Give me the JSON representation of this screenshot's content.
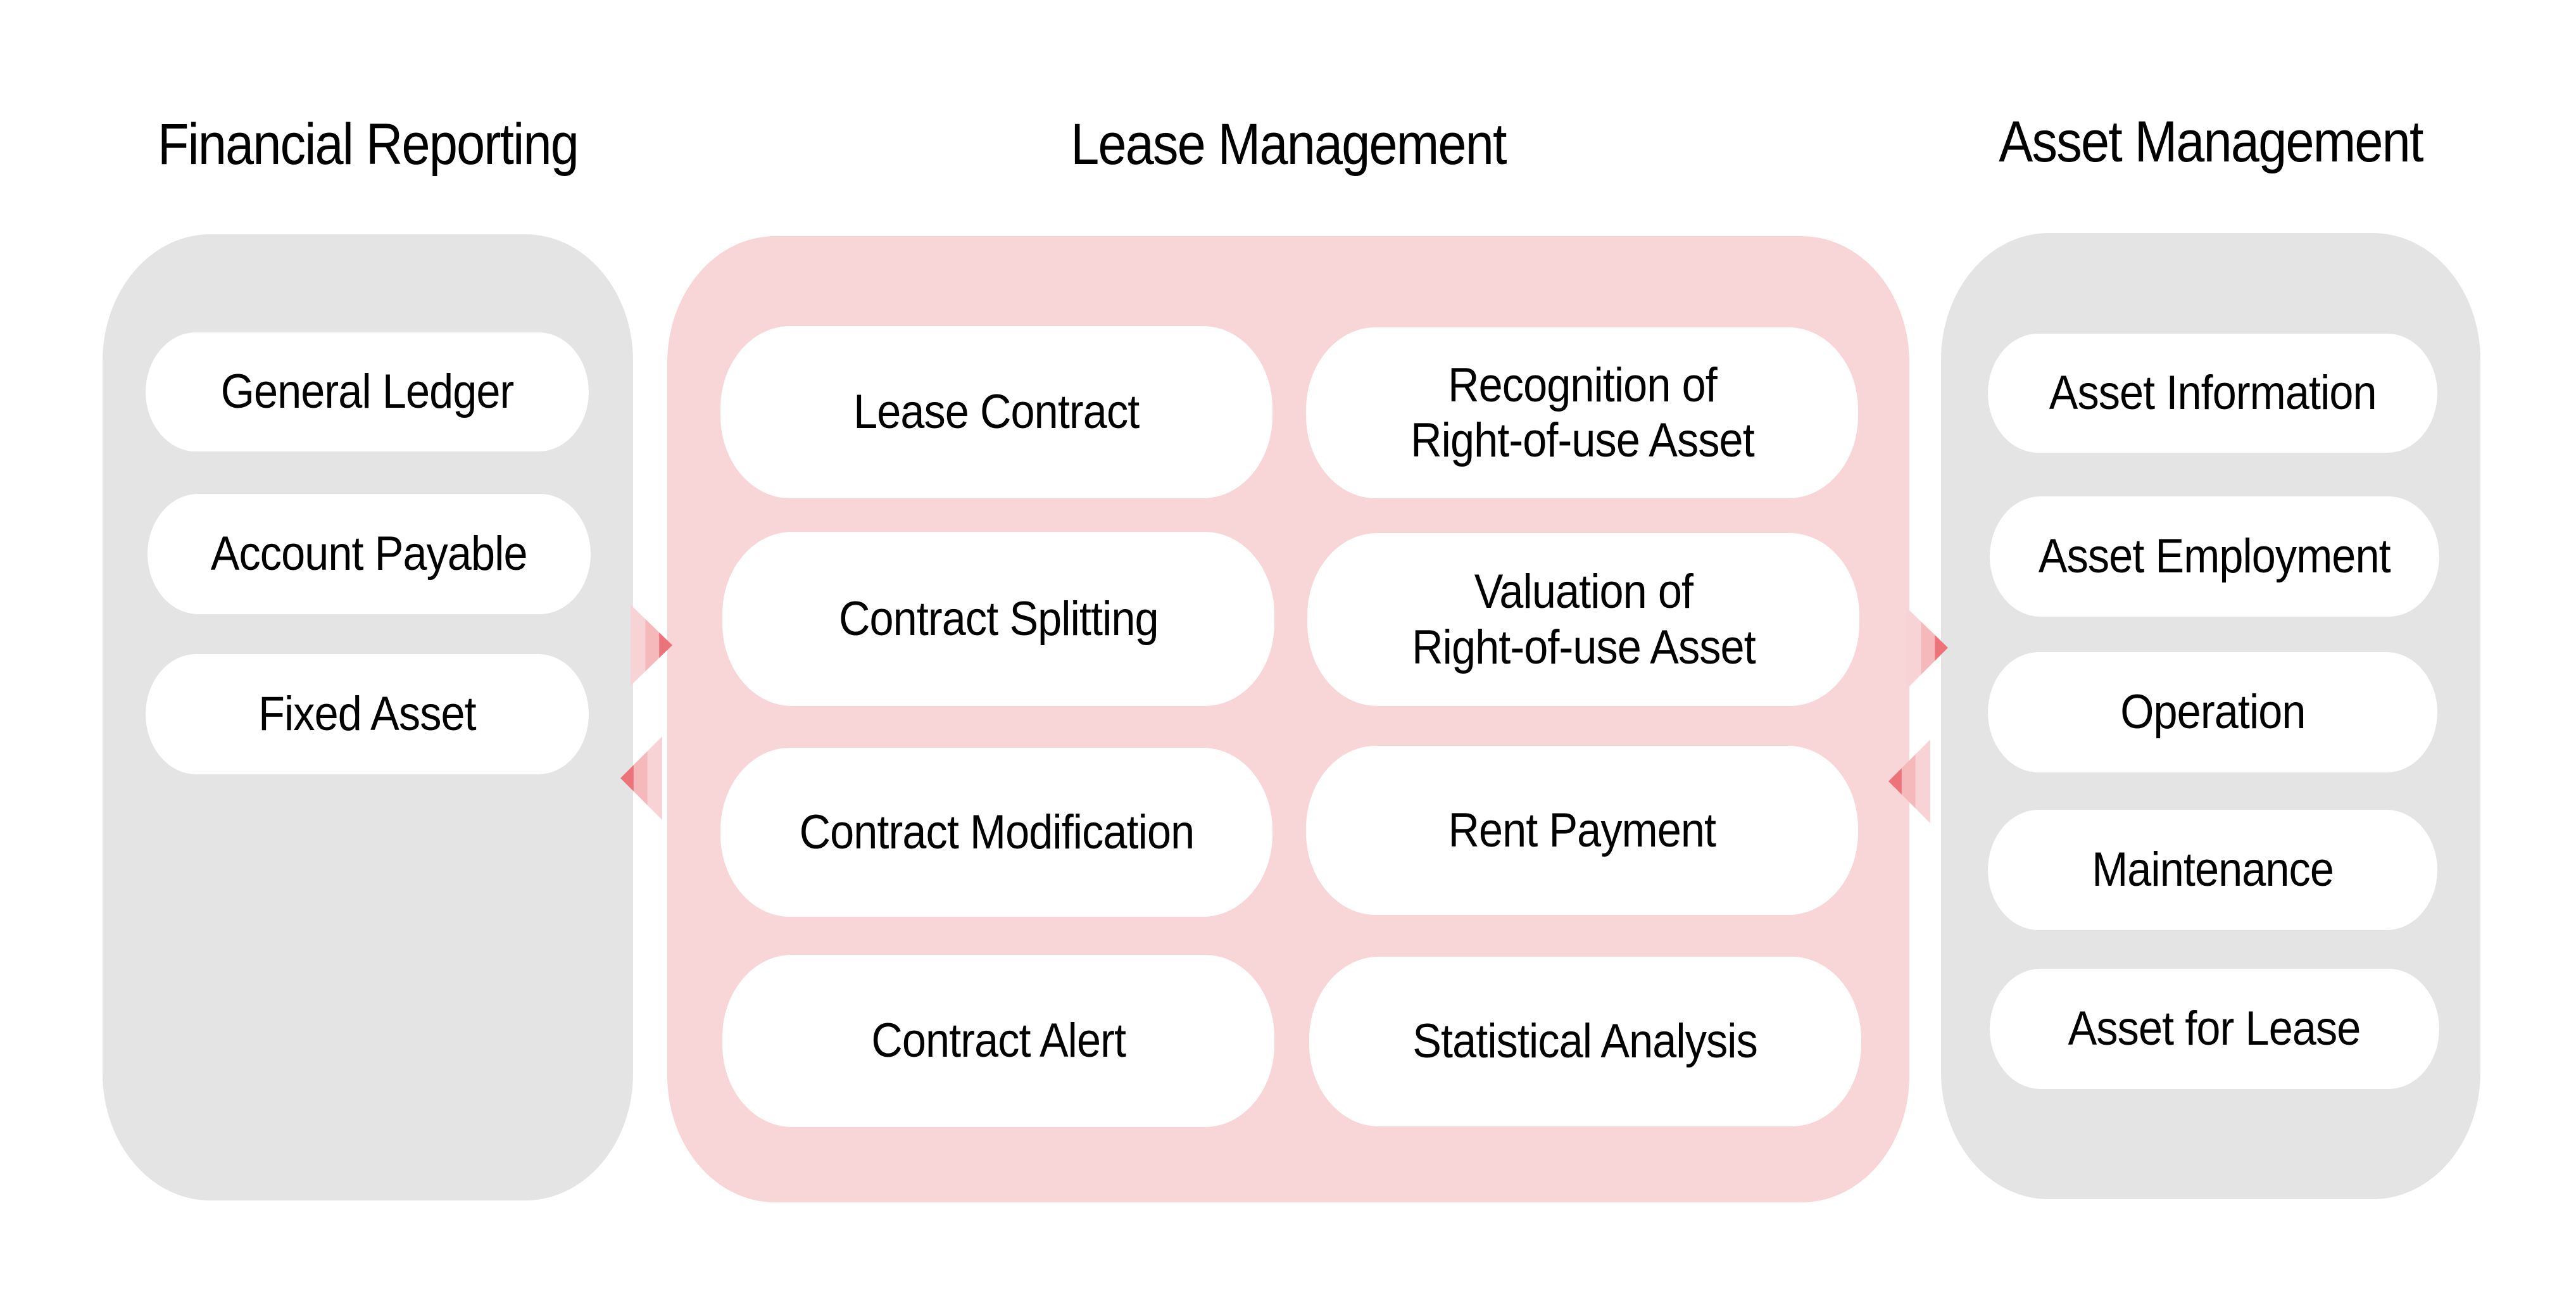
{
  "colors": {
    "side_panel": "#e4e4e4",
    "center_panel": "#f8d5d6",
    "item_bg": "#ffffff",
    "arrow_dark": "#ec737a",
    "arrow_mid": "#f5b8bb",
    "arrow_light": "#f8d3d5"
  },
  "financial_reporting": {
    "title": "Financial Reporting",
    "items": [
      "General Ledger",
      "Account Payable",
      "Fixed Asset"
    ]
  },
  "lease_management": {
    "title": "Lease Management",
    "items": [
      "Lease Contract",
      "Recognition of\nRight-of-use Asset",
      "Contract Splitting",
      "Valuation of\nRight-of-use Asset",
      "Contract Modification",
      "Rent Payment",
      "Contract Alert",
      "Statistical Analysis"
    ]
  },
  "asset_management": {
    "title": "Asset Management",
    "items": [
      "Asset Information",
      "Asset Employment",
      "Operation",
      "Maintenance",
      "Asset for Lease"
    ]
  },
  "connectors": [
    {
      "from": "financial_reporting",
      "to": "lease_management",
      "direction": "right"
    },
    {
      "from": "lease_management",
      "to": "financial_reporting",
      "direction": "left"
    },
    {
      "from": "lease_management",
      "to": "asset_management",
      "direction": "right"
    },
    {
      "from": "asset_management",
      "to": "lease_management",
      "direction": "left"
    }
  ]
}
